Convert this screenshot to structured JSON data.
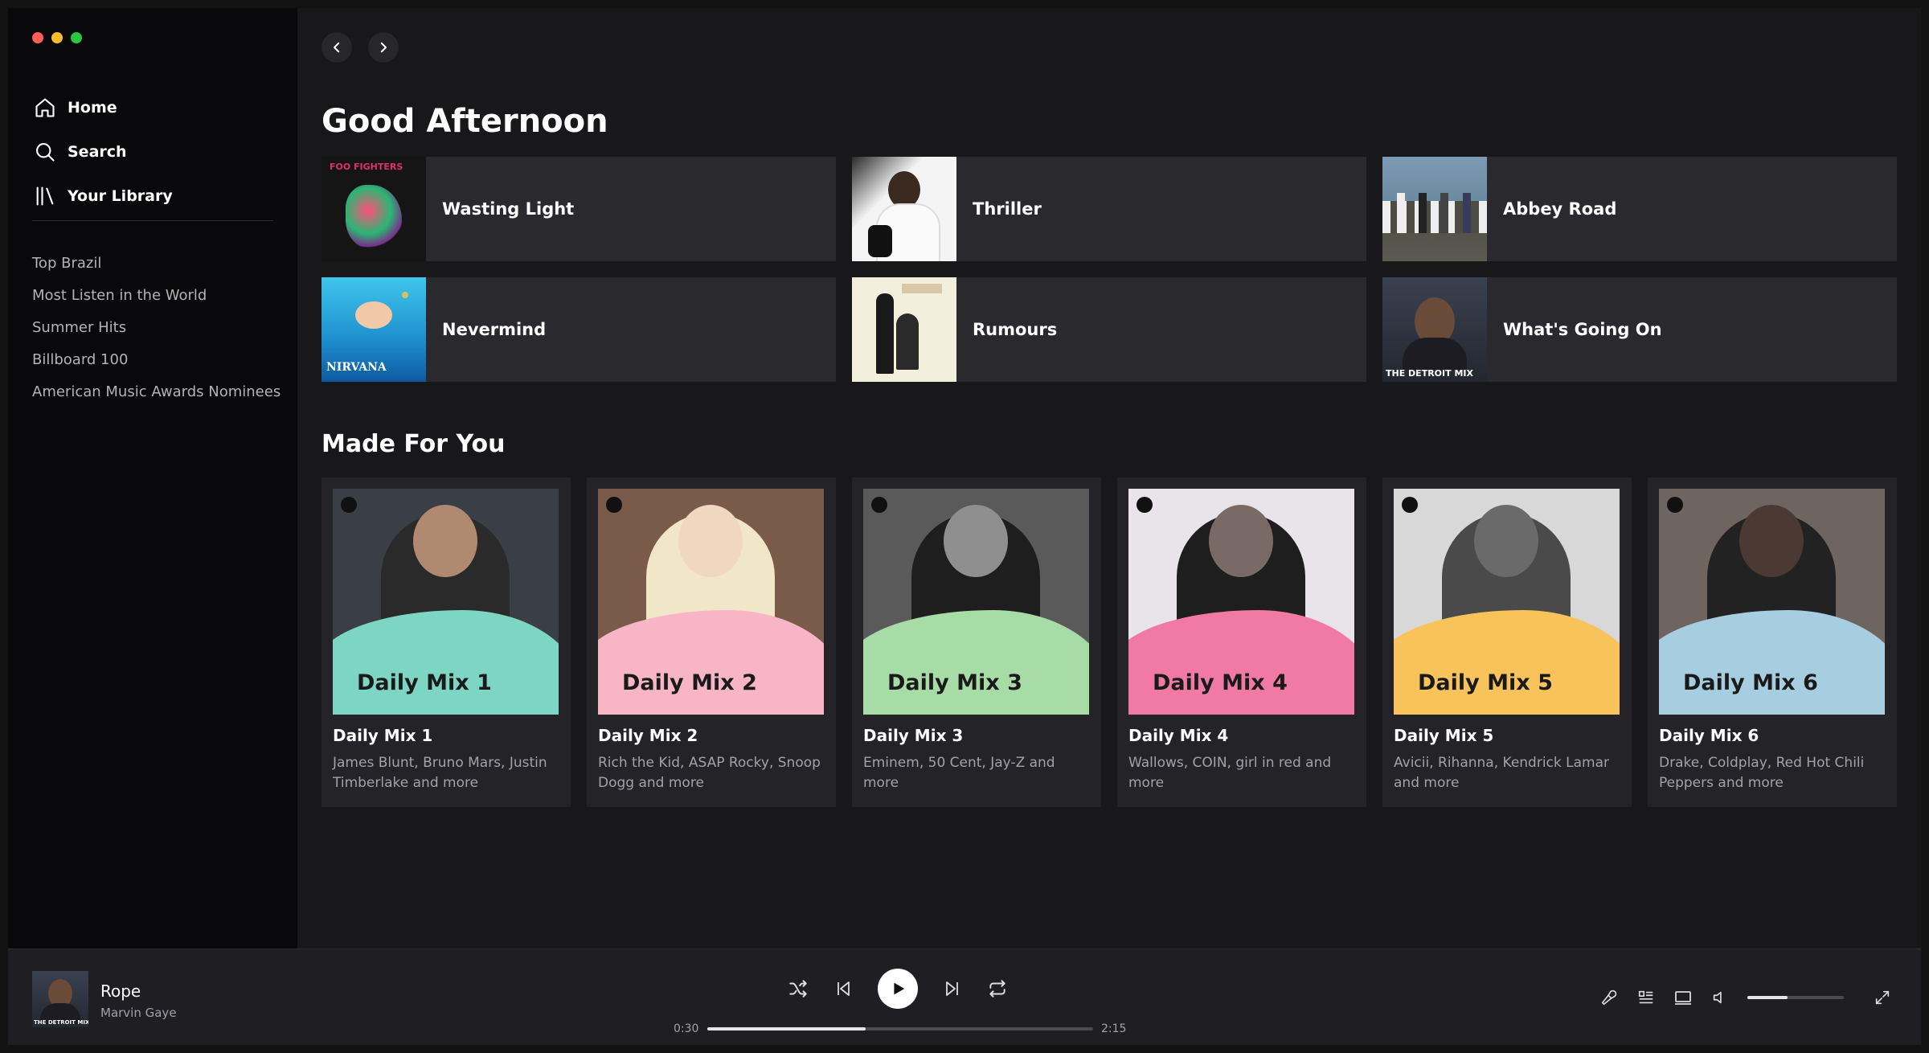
{
  "window": {
    "traffic_colors": [
      "#ff5f57",
      "#febc2e",
      "#28c840"
    ]
  },
  "sidebar": {
    "nav": [
      {
        "label": "Home",
        "icon": "home-icon"
      },
      {
        "label": "Search",
        "icon": "search-icon"
      },
      {
        "label": "Your Library",
        "icon": "library-icon"
      }
    ],
    "playlists": [
      "Top Brazil",
      "Most Listen in the World",
      "Summer Hits",
      "Billboard 100",
      "American Music Awards Nominees"
    ]
  },
  "main": {
    "greeting": "Good Afternoon",
    "quick_picks": [
      {
        "title": "Wasting Light",
        "art_color": "#1b1b1b",
        "accent": "#e0306a"
      },
      {
        "title": "Thriller",
        "art_color": "#f4f4f4",
        "accent": "#222222"
      },
      {
        "title": "Abbey Road",
        "art_color": "#6d8aa6",
        "accent": "#4a4a3c"
      },
      {
        "title": "Nevermind",
        "art_color": "#1e9fd6",
        "accent": "#0d3f7a"
      },
      {
        "title": "Rumours",
        "art_color": "#f2eedf",
        "accent": "#1b1b1b"
      },
      {
        "title": "What's Going On",
        "art_color": "#2e3440",
        "accent": "#8a6b4e"
      }
    ],
    "quick_art_captions": {
      "nevermind": "NIRVANA",
      "whats_going_on": "THE DETROIT MIX",
      "wasting_light": "FOO FIGHTERS"
    },
    "section_title": "Made For You",
    "mixes": [
      {
        "title": "Daily Mix 1",
        "label": "Daily Mix 1",
        "subtitle": "James Blunt, Bruno Mars, Justin Timberlake and more",
        "wave": "#7dd6c4",
        "bg": "#3a3f45",
        "skin": "#b08a70"
      },
      {
        "title": "Daily Mix 2",
        "label": "Daily Mix 2",
        "subtitle": "Rich the Kid, ASAP Rocky, Snoop Dogg and more",
        "wave": "#f7b5c6",
        "bg": "#7a5a48",
        "skin": "#efd7c0"
      },
      {
        "title": "Daily Mix 3",
        "label": "Daily Mix 3",
        "subtitle": "Eminem, 50 Cent, Jay-Z and more",
        "wave": "#a8dca6",
        "bg": "#5a5a5a",
        "skin": "#8f8f8f"
      },
      {
        "title": "Daily Mix 4",
        "label": "Daily Mix 4",
        "subtitle": "Wallows, COIN, girl in red and more",
        "wave": "#f07aa4",
        "bg": "#e8e4ea",
        "skin": "#7a6a66"
      },
      {
        "title": "Daily Mix 5",
        "label": "Daily Mix 5",
        "subtitle": "Avicii, Rihanna, Kendrick Lamar and more",
        "wave": "#f8c35a",
        "bg": "#d8d8d8",
        "skin": "#6a6a6a"
      },
      {
        "title": "Daily Mix 6",
        "label": "Daily Mix 6",
        "subtitle": "Drake, Coldplay, Red Hot Chili Peppers and more",
        "wave": "#a6cde0",
        "bg": "#6e6460",
        "skin": "#4a3a33"
      }
    ]
  },
  "player": {
    "track": "Rope",
    "artist": "Marvin Gaye",
    "elapsed": "0:30",
    "duration": "2:15",
    "progress_fraction": 0.41,
    "volume_fraction": 0.42,
    "art_caption": "THE DETROIT MIX"
  }
}
